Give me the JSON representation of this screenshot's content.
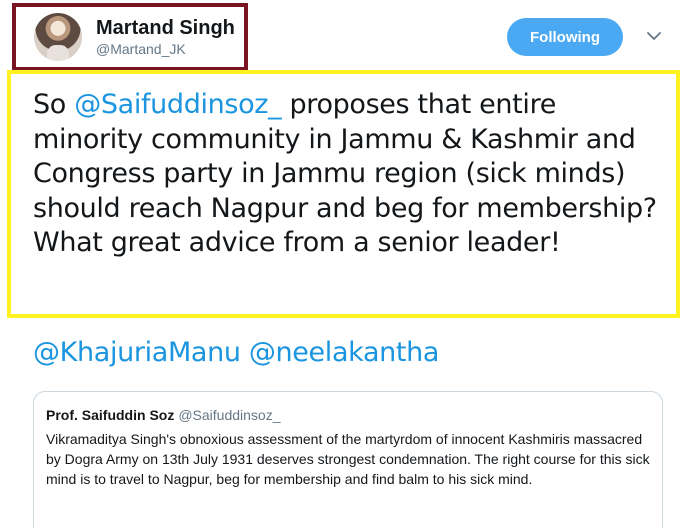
{
  "author": {
    "display_name": "Martand Singh",
    "handle": "@Martand_JK"
  },
  "follow_button": {
    "label": "Following",
    "color": "#4aa9f2"
  },
  "highlight_colors": {
    "profile_box": "#7b1421",
    "tweet_box": "#fff21e",
    "link": "#1b95e0"
  },
  "tweet": {
    "prefix": "So ",
    "mention": "@Saifuddinsoz_",
    "body": " proposes that entire minority community in Jammu & Kashmir and Congress party in Jammu region (sick minds) should reach Nagpur and beg for membership? What great advice from a senior leader!"
  },
  "reply_mentions": [
    "@KhajuriaManu",
    "@neelakantha"
  ],
  "quoted_tweet": {
    "name": "Prof. Saifuddin Soz",
    "handle": "@Saifuddinsoz_",
    "text": "Vikramaditya  Singh's obnoxious assessment  of the martyrdom of innocent Kashmiris massacred by Dogra Army on 13th July 1931 deserves strongest condemnation. The right course for this sick mind is to travel to Nagpur, beg for membership and find balm to his sick mind."
  },
  "icons": {
    "avatar": "avatar",
    "more": "chevron-down-icon"
  }
}
